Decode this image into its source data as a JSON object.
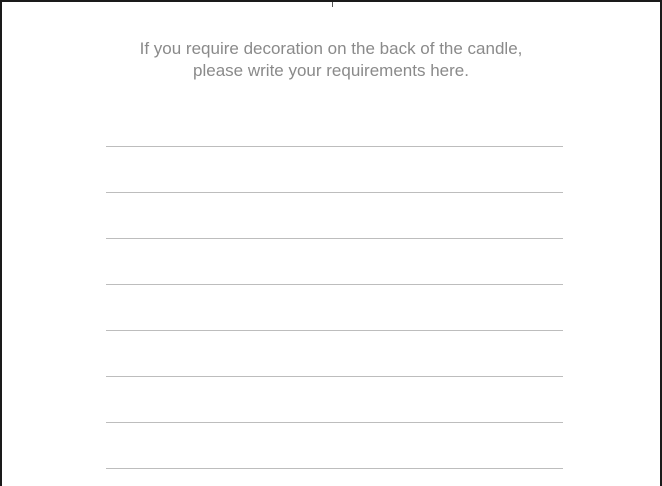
{
  "instructions": {
    "line1": "If you require decoration on the back of the candle,",
    "line2": "please write your requirements here."
  },
  "writing_area": {
    "line_count": 8
  }
}
